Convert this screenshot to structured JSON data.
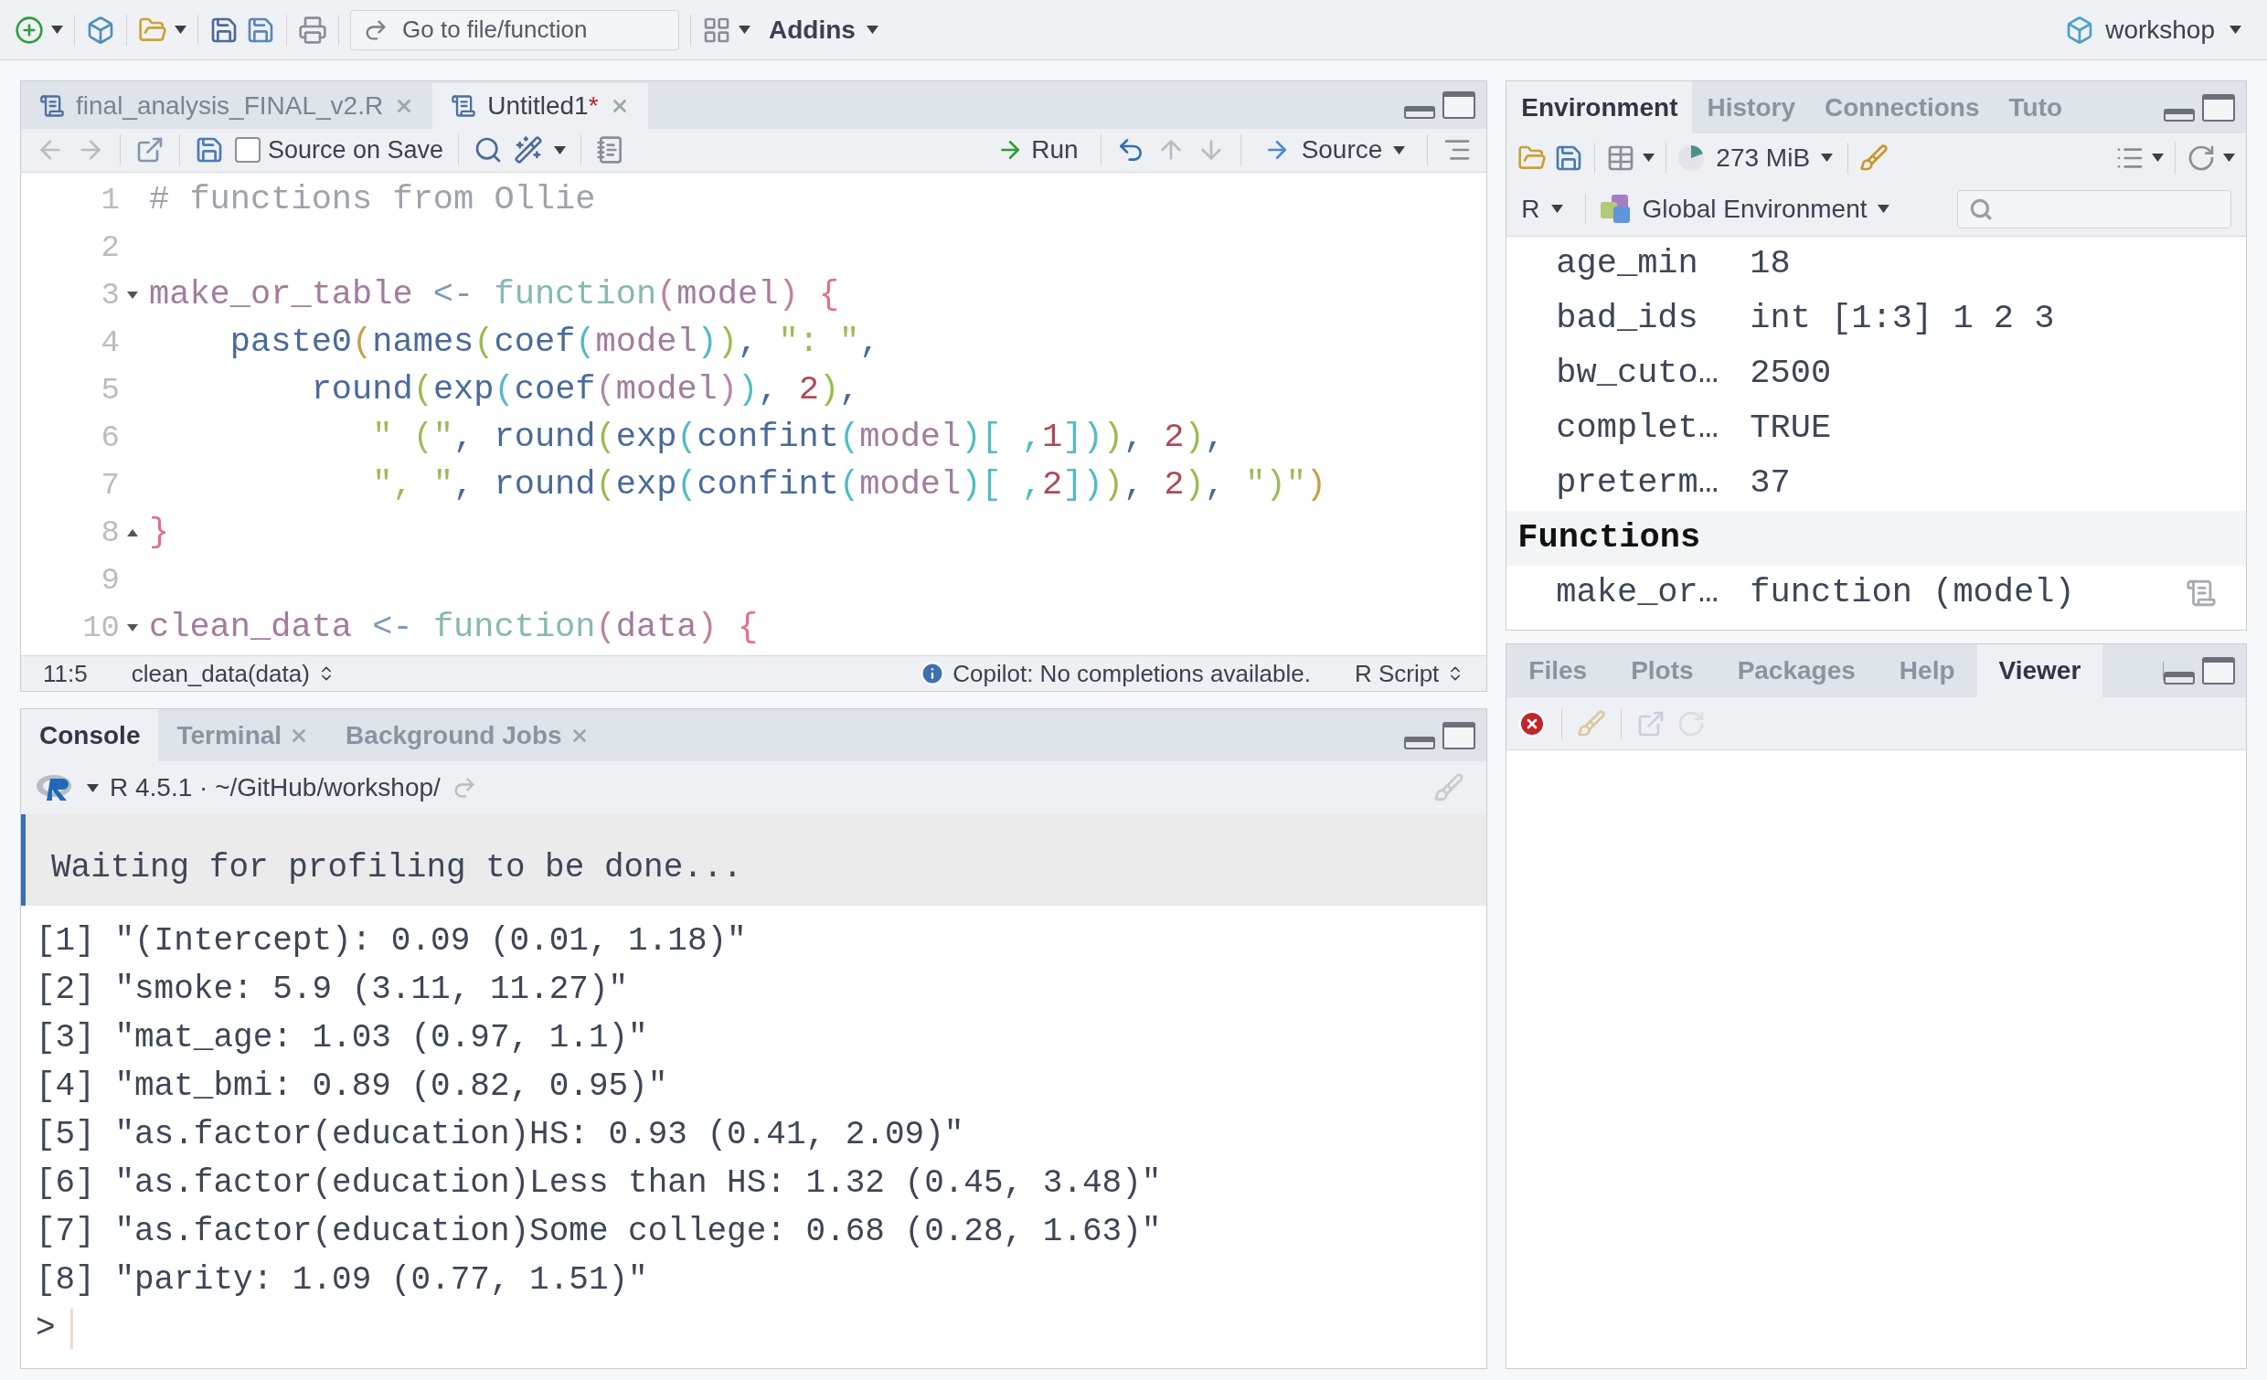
{
  "toolbar": {
    "file_search": {
      "placeholder": "Go to file/function"
    },
    "addins_menu": "Addins",
    "project": "workshop"
  },
  "editor": {
    "tabs": [
      {
        "label": "final_analysis_FINAL_v2.R",
        "selected": false
      },
      {
        "label": "Untitled1",
        "unsaved_mark": "*",
        "selected": true
      }
    ],
    "source_on_save": {
      "label": "Source on Save",
      "checked": false
    },
    "run_label": "Run",
    "source_label": "Source",
    "lines": [
      {
        "number": "1",
        "tokens": [
          {
            "text": "# functions from Ollie",
            "color": "#9ea3ab"
          }
        ]
      },
      {
        "number": "2"
      },
      {
        "number": "3",
        "fold_start": true,
        "tokens": [
          {
            "text": "make_or_table",
            "color": "#a27c9e"
          },
          {
            "text": " <- ",
            "color": "#7d9bb5"
          },
          {
            "text": "function",
            "color": "#86b8b3"
          },
          {
            "text": "(",
            "color": "#c27fa0"
          },
          {
            "text": "model",
            "color": "#a27c9e"
          },
          {
            "text": ")",
            "color": "#c27fa0"
          },
          {
            "text": " {",
            "color": "#e46d86"
          }
        ]
      },
      {
        "number": "4",
        "tokens": [
          {
            "text": "    paste0",
            "color": "#4a6a9a"
          },
          {
            "text": "(",
            "color": "#c99d48"
          },
          {
            "text": "names",
            "color": "#4a6a9a"
          },
          {
            "text": "(",
            "color": "#9cbb4e"
          },
          {
            "text": "coef",
            "color": "#4a6a9a"
          },
          {
            "text": "(",
            "color": "#4fbcc6"
          },
          {
            "text": "model",
            "color": "#a27c9e"
          },
          {
            "text": ")",
            "color": "#4fbcc6"
          },
          {
            "text": ")",
            "color": "#9cbb4e"
          },
          {
            "text": ", ",
            "color": "#4a6a9a"
          },
          {
            "text": "\": \"",
            "color": "#9cbb5a"
          },
          {
            "text": ",",
            "color": "#4a6a9a"
          }
        ]
      },
      {
        "number": "5",
        "tokens": [
          {
            "text": "        round",
            "color": "#4a6a9a"
          },
          {
            "text": "(",
            "color": "#9cbb4e"
          },
          {
            "text": "exp",
            "color": "#4a6a9a"
          },
          {
            "text": "(",
            "color": "#4fbcc6"
          },
          {
            "text": "coef",
            "color": "#4a6a9a"
          },
          {
            "text": "(",
            "color": "#b088b0"
          },
          {
            "text": "model",
            "color": "#a27c9e"
          },
          {
            "text": ")",
            "color": "#b088b0"
          },
          {
            "text": ")",
            "color": "#4fbcc6"
          },
          {
            "text": ", ",
            "color": "#4a6a9a"
          },
          {
            "text": "2",
            "color": "#b0485a"
          },
          {
            "text": ")",
            "color": "#9cbb4e"
          },
          {
            "text": ",",
            "color": "#4a6a9a"
          }
        ]
      },
      {
        "number": "6",
        "tokens": [
          {
            "text": "           \" (\"",
            "color": "#9cbb5a"
          },
          {
            "text": ", round",
            "color": "#4a6a9a"
          },
          {
            "text": "(",
            "color": "#9cbb4e"
          },
          {
            "text": "exp",
            "color": "#4a6a9a"
          },
          {
            "text": "(",
            "color": "#4fbcc6"
          },
          {
            "text": "confint",
            "color": "#4a6a9a"
          },
          {
            "text": "(",
            "color": "#4fbcc6"
          },
          {
            "text": "model",
            "color": "#a27c9e"
          },
          {
            "text": ")[ ,",
            "color": "#4fbcc6"
          },
          {
            "text": "1",
            "color": "#b0485a"
          },
          {
            "text": "])",
            "color": "#4fbcc6"
          },
          {
            "text": ")",
            "color": "#9cbb4e"
          },
          {
            "text": ", ",
            "color": "#4a6a9a"
          },
          {
            "text": "2",
            "color": "#b0485a"
          },
          {
            "text": ")",
            "color": "#9cbb4e"
          },
          {
            "text": ",",
            "color": "#4a6a9a"
          }
        ]
      },
      {
        "number": "7",
        "tokens": [
          {
            "text": "           \", \"",
            "color": "#9cbb5a"
          },
          {
            "text": ", round",
            "color": "#4a6a9a"
          },
          {
            "text": "(",
            "color": "#9cbb4e"
          },
          {
            "text": "exp",
            "color": "#4a6a9a"
          },
          {
            "text": "(",
            "color": "#4fbcc6"
          },
          {
            "text": "confint",
            "color": "#4a6a9a"
          },
          {
            "text": "(",
            "color": "#4fbcc6"
          },
          {
            "text": "model",
            "color": "#a27c9e"
          },
          {
            "text": ")[ ,",
            "color": "#4fbcc6"
          },
          {
            "text": "2",
            "color": "#b0485a"
          },
          {
            "text": "])",
            "color": "#4fbcc6"
          },
          {
            "text": ")",
            "color": "#9cbb4e"
          },
          {
            "text": ", ",
            "color": "#4a6a9a"
          },
          {
            "text": "2",
            "color": "#b0485a"
          },
          {
            "text": ")",
            "color": "#9cbb4e"
          },
          {
            "text": ", ",
            "color": "#4a6a9a"
          },
          {
            "text": "\")\"",
            "color": "#9cbb5a"
          },
          {
            "text": ")",
            "color": "#c99d48"
          }
        ]
      },
      {
        "number": "8",
        "fold_end": true,
        "tokens": [
          {
            "text": "}",
            "color": "#e46d86"
          }
        ]
      },
      {
        "number": "9"
      },
      {
        "number": "10",
        "fold_start": true,
        "tokens": [
          {
            "text": "clean_data",
            "color": "#a27c9e"
          },
          {
            "text": " <- ",
            "color": "#7d9bb5"
          },
          {
            "text": "function",
            "color": "#86b8b3"
          },
          {
            "text": "(",
            "color": "#c27fa0"
          },
          {
            "text": "data",
            "color": "#a27c9e"
          },
          {
            "text": ")",
            "color": "#c27fa0"
          },
          {
            "text": " {",
            "color": "#e46d86"
          }
        ]
      }
    ],
    "status": {
      "position": "11:5",
      "scope": "clean_data(data)",
      "copilot": "Copilot: No completions available.",
      "file_type": "R Script"
    }
  },
  "console": {
    "tabs": [
      {
        "label": "Console",
        "selected": true,
        "closable": false
      },
      {
        "label": "Terminal",
        "selected": false,
        "closable": true
      },
      {
        "label": "Background Jobs",
        "selected": false,
        "closable": true
      }
    ],
    "session": "R 4.5.1 · ~/GitHub/workshop/",
    "messages": [
      "Waiting for profiling to be done..."
    ],
    "output": [
      "[1] \"(Intercept): 0.09 (0.01, 1.18)\"",
      "[2] \"smoke: 5.9 (3.11, 11.27)\"",
      "[3] \"mat_age: 1.03 (0.97, 1.1)\"",
      "[4] \"mat_bmi: 0.89 (0.82, 0.95)\"",
      "[5] \"as.factor(education)HS: 0.93 (0.41, 2.09)\"",
      "[6] \"as.factor(education)Less than HS: 1.32 (0.45, 3.48)\"",
      "[7] \"as.factor(education)Some college: 0.68 (0.28, 1.63)\"",
      "[8] \"parity: 1.09 (0.77, 1.51)\""
    ],
    "prompt": ">"
  },
  "environment": {
    "tabs": [
      {
        "label": "Environment",
        "selected": true
      },
      {
        "label": "History",
        "selected": false
      },
      {
        "label": "Connections",
        "selected": false
      },
      {
        "label": "Tuto",
        "selected": false
      }
    ],
    "memory": "273 MiB",
    "language": "R",
    "scope": "Global Environment",
    "rows": [
      {
        "kind": "value",
        "name": "age_min",
        "value": "18"
      },
      {
        "kind": "value",
        "name": "bad_ids",
        "value": "int [1:3] 1 2 3"
      },
      {
        "kind": "value",
        "name": "bw_cuto…",
        "value": "2500"
      },
      {
        "kind": "value",
        "name": "complet…",
        "value": "TRUE"
      },
      {
        "kind": "value",
        "name": "preterm…",
        "value": "37"
      },
      {
        "kind": "section",
        "name": "Functions"
      },
      {
        "kind": "function",
        "name": "make_or…",
        "value": "function (model)"
      }
    ]
  },
  "viewer_pane": {
    "tabs": [
      {
        "label": "Files",
        "selected": false
      },
      {
        "label": "Plots",
        "selected": false
      },
      {
        "label": "Packages",
        "selected": false
      },
      {
        "label": "Help",
        "selected": false
      },
      {
        "label": "Viewer",
        "selected": true
      }
    ]
  }
}
